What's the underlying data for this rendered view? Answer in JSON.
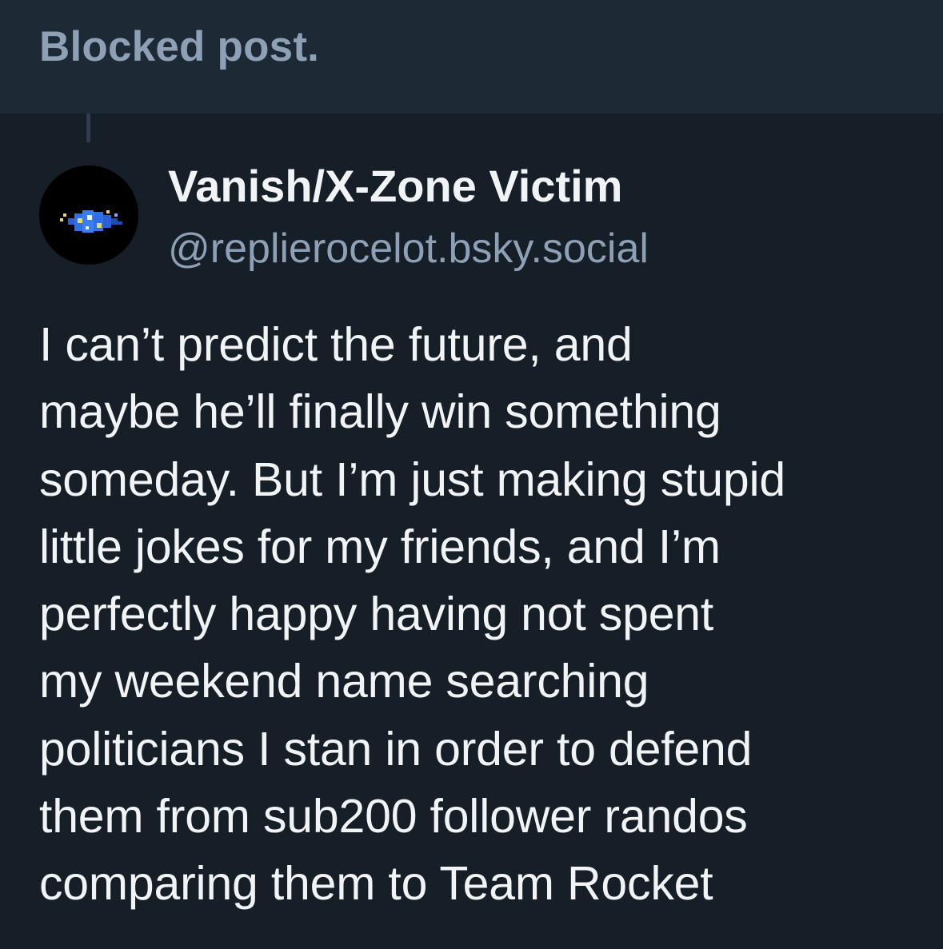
{
  "blocked_banner": {
    "text": "Blocked post."
  },
  "post": {
    "author": {
      "display_name": "Vanish/X-Zone Victim",
      "handle": "@replierocelot.bsky.social",
      "avatar_icon": "pixel-creature-avatar"
    },
    "text_lines": [
      "I can’t predict the future, and",
      "maybe he’ll finally win something",
      "someday. But I’m just making stupid",
      "little jokes for my friends, and I’m",
      "perfectly happy having not spent",
      "my weekend name searching",
      "politicians I stan in order to defend",
      "them from sub200 follower randos",
      "comparing them to Team Rocket"
    ]
  },
  "colors": {
    "background": "#161e27",
    "banner_background": "#1e2936",
    "muted_text": "#8ea0b6",
    "primary_text": "#f1f3f5"
  }
}
